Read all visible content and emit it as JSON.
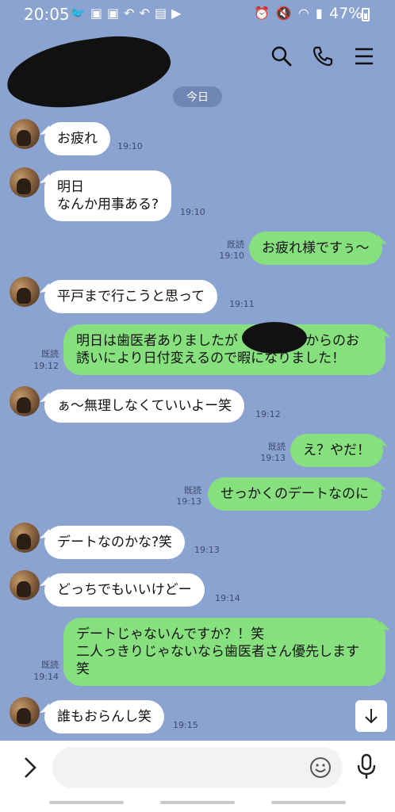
{
  "status_bar": {
    "time": "20:05",
    "left_icons": [
      "twitter-icon",
      "cat-icon",
      "photo-icon",
      "share-icon",
      "share-icon",
      "briefcase-icon",
      "youtube-icon"
    ],
    "right_icons": [
      "alarm-icon",
      "mute-icon",
      "wifi-icon",
      "signal-icon"
    ],
    "battery": "47%",
    "battery_level": 0.47
  },
  "header": {
    "icons": [
      "search-icon",
      "phone-icon",
      "menu-icon"
    ]
  },
  "date_separator": "今日",
  "messages": [
    {
      "side": "in",
      "text": "お疲れ",
      "time": "19:10"
    },
    {
      "side": "in",
      "text": "明日\nなんか用事ある?",
      "time": "19:10"
    },
    {
      "side": "out",
      "text": "お疲れ様ですぅ〜",
      "read": "既読",
      "time": "19:10"
    },
    {
      "side": "in",
      "text": "平戸まで行こうと思って",
      "time": "19:11"
    },
    {
      "side": "out",
      "text": "明日は歯医者ありましたが　　　　んからのお\n誘いにより日付変えるので暇になりました！",
      "read": "既読",
      "time": "19:12"
    },
    {
      "side": "in",
      "text": "ぁ〜無理しなくていいよー笑",
      "time": "19:12"
    },
    {
      "side": "out",
      "text": "え？やだ！",
      "read": "既読",
      "time": "19:13"
    },
    {
      "side": "out",
      "text": "せっかくのデートなのに",
      "read": "既読",
      "time": "19:13"
    },
    {
      "side": "in",
      "text": "デートなのかな?笑",
      "time": "19:13"
    },
    {
      "side": "in",
      "text": "どっちでもいいけどー",
      "time": "19:14"
    },
    {
      "side": "out",
      "text": "デートじゃないんですか？！笑\n二人っきりじゃないなら歯医者さん優先します\n笑",
      "read": "既読",
      "time": "19:14"
    },
    {
      "side": "in",
      "text": "誰もおらんし笑",
      "time": "19:15"
    }
  ],
  "input": {
    "value": "",
    "placeholder": ""
  },
  "colors": {
    "background": "#8ba3d0",
    "outgoing_bubble": "#87e07e",
    "incoming_bubble": "#ffffff"
  }
}
